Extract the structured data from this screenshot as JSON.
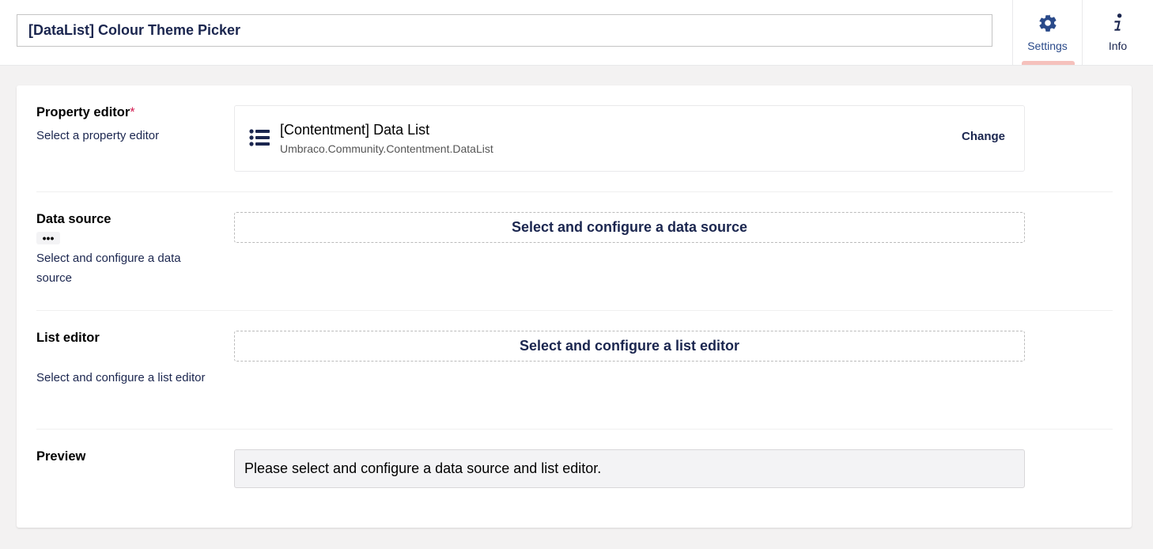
{
  "header": {
    "name_value": "[DataList] Colour Theme Picker",
    "apps": [
      {
        "label": "Settings",
        "icon": "gear-icon",
        "active": true
      },
      {
        "label": "Info",
        "icon": "info-icon",
        "active": false
      }
    ]
  },
  "property_editor": {
    "label": "Property editor",
    "required_marker": "*",
    "description": "Select a property editor",
    "editor_name": "[Contentment] Data List",
    "editor_alias": "Umbraco.Community.Contentment.DataList",
    "editor_icon": "list-icon",
    "change_label": "Change"
  },
  "data_source": {
    "label": "Data source",
    "dots_label": "•••",
    "description": "Select and configure a data source",
    "button_label": "Select and configure a data source"
  },
  "list_editor": {
    "label": "List editor",
    "description": "Select and configure a list editor",
    "button_label": "Select and configure a list editor"
  },
  "preview": {
    "label": "Preview",
    "message": "Please select and configure a data source and list editor."
  },
  "colors": {
    "text_primary": "#1b264f",
    "required": "#d42054",
    "active_tab_indicator": "#f5c1bc",
    "settings_icon": "#2a4a8a"
  }
}
